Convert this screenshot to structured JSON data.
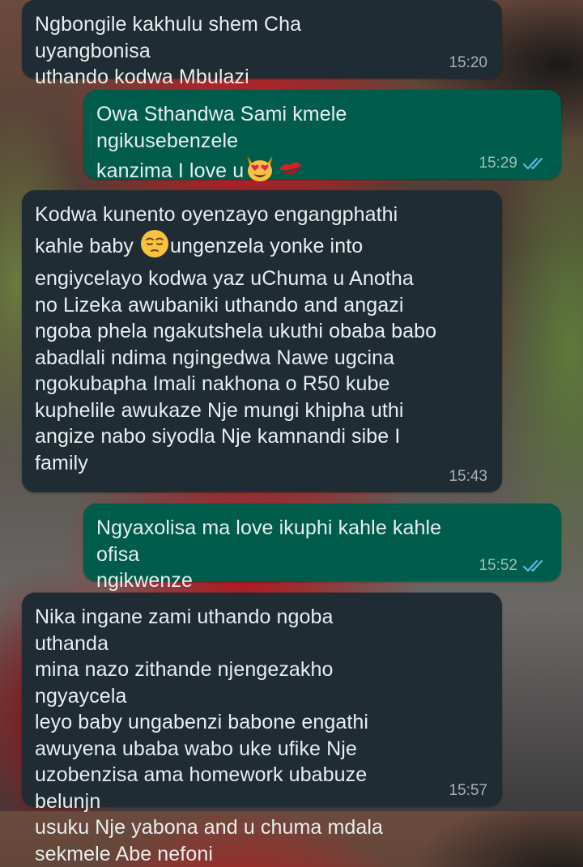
{
  "messages": [
    {
      "direction": "in",
      "text": "Ngbongile kakhulu shem Cha uyangbonisa\nuthando kodwa Mbulazi",
      "time": "15:20"
    },
    {
      "direction": "out",
      "text_before_emoji": "Owa Sthandwa Sami kmele ngikusebenzele\nkanzima I love u",
      "emojis": [
        "heart-eyes-cat-emoji",
        "kiss-mark-emoji"
      ],
      "time": "15:29",
      "status": "read"
    },
    {
      "direction": "in",
      "text_before_emoji": "Kodwa kunento oyenzayo engangphathi\nkahle baby ",
      "emoji": "pensive-face-emoji",
      "text_after_emoji": "ungenzela yonke into\nengiycelayo kodwa yaz uChuma u Anotha\nno Lizeka awubaniki uthando and angazi\nngoba phela ngakutshela ukuthi obaba babo\nabadlali ndima ngingedwa Nawe ugcina\nngokubapha Imali nakhona o R50 kube\nkuphelile awukaze Nje mungi khipha uthi\nangize nabo siyodla Nje kamnandi sibe I\nfamily",
      "time": "15:43"
    },
    {
      "direction": "out",
      "text": "Ngyaxolisa ma love ikuphi kahle kahle ofisa\nngikwenze",
      "time": "15:52",
      "status": "read"
    },
    {
      "direction": "in",
      "text": "Nika ingane zami uthando ngoba uthanda\nmina nazo zithande njengezakho ngyaycela\nleyo baby ungabenzi babone engathi\nawuyena ubaba wabo uke ufike Nje\nuzobenzisa ama homework ubabuze belunjn\nusuku Nje yabona and u chuma mdala\nsekmele Abe nefoni",
      "time": "15:57"
    }
  ],
  "colors": {
    "incoming_bubble": "#1f2c34",
    "outgoing_bubble": "#005c4b",
    "text": "#e9edef",
    "read_ticks": "#53bdeb"
  }
}
